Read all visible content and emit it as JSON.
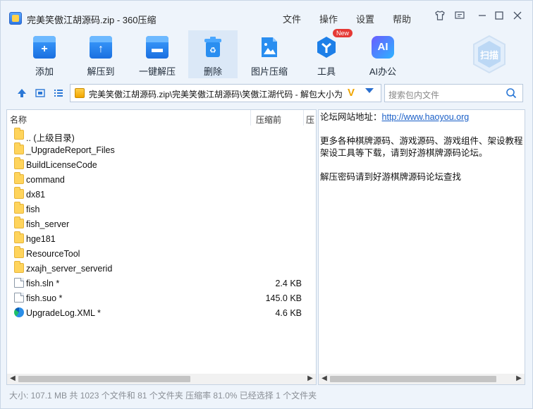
{
  "window": {
    "title": "完美笑傲江胡源码.zip - 360压缩",
    "menu": [
      "文件",
      "操作",
      "设置",
      "帮助"
    ],
    "controls": [
      "shirt-icon",
      "feedback-icon",
      "minimize-icon",
      "maximize-icon",
      "close-icon"
    ]
  },
  "toolbar": {
    "items": [
      {
        "label": "添加",
        "icon": "add-icon"
      },
      {
        "label": "解压到",
        "icon": "extract-to-icon"
      },
      {
        "label": "一键解压",
        "icon": "one-click-extract-icon"
      },
      {
        "label": "删除",
        "icon": "delete-icon"
      },
      {
        "label": "图片压缩",
        "icon": "image-compress-icon"
      },
      {
        "label": "工具",
        "icon": "tools-icon",
        "badge": "New"
      },
      {
        "label": "AI办公",
        "icon": "ai-office-icon",
        "glyph": "AI"
      }
    ],
    "scan_label": "扫描"
  },
  "pathbar": {
    "path": "完美笑傲江胡源码.zip\\完美笑傲江胡源码\\笑傲江湖代码 - 解包大小为",
    "search_placeholder": "搜索包内文件"
  },
  "file_list": {
    "columns": [
      "名称",
      "压缩前",
      "压"
    ],
    "rows": [
      {
        "name": ".. (上级目录)",
        "type": "folder",
        "size": ""
      },
      {
        "name": "_UpgradeReport_Files",
        "type": "folder",
        "size": ""
      },
      {
        "name": "BuildLicenseCode",
        "type": "folder",
        "size": ""
      },
      {
        "name": "command",
        "type": "folder",
        "size": ""
      },
      {
        "name": "dx81",
        "type": "folder",
        "size": ""
      },
      {
        "name": "fish",
        "type": "folder",
        "size": ""
      },
      {
        "name": "fish_server",
        "type": "folder",
        "size": ""
      },
      {
        "name": "hge181",
        "type": "folder",
        "size": ""
      },
      {
        "name": "ResourceTool",
        "type": "folder",
        "size": ""
      },
      {
        "name": "zxajh_server_serverid",
        "type": "folder",
        "size": ""
      },
      {
        "name": "fish.sln *",
        "type": "file",
        "size": "2.4 KB"
      },
      {
        "name": "fish.suo *",
        "type": "file",
        "size": "145.0 KB"
      },
      {
        "name": "UpgradeLog.XML *",
        "type": "xml",
        "size": "4.6 KB"
      }
    ]
  },
  "notice": {
    "line1_prefix": "论坛网站地址：",
    "line1_link": "http://www.haoyou.org",
    "line2": "更多各种棋牌源码、游戏源码、游戏组件、架设教程",
    "line3": "架设工具等下载，请到好游棋牌源码论坛。",
    "line4": "解压密码请到好游棋牌源码论坛查找"
  },
  "status": "大小: 107.1 MB 共 1023 个文件和 81 个文件夹 压缩率 81.0% 已经选择 1 个文件夹",
  "colors": {
    "accent": "#1a6fe0",
    "window_bg": "#eef4fb",
    "link": "#1a5fc7"
  }
}
